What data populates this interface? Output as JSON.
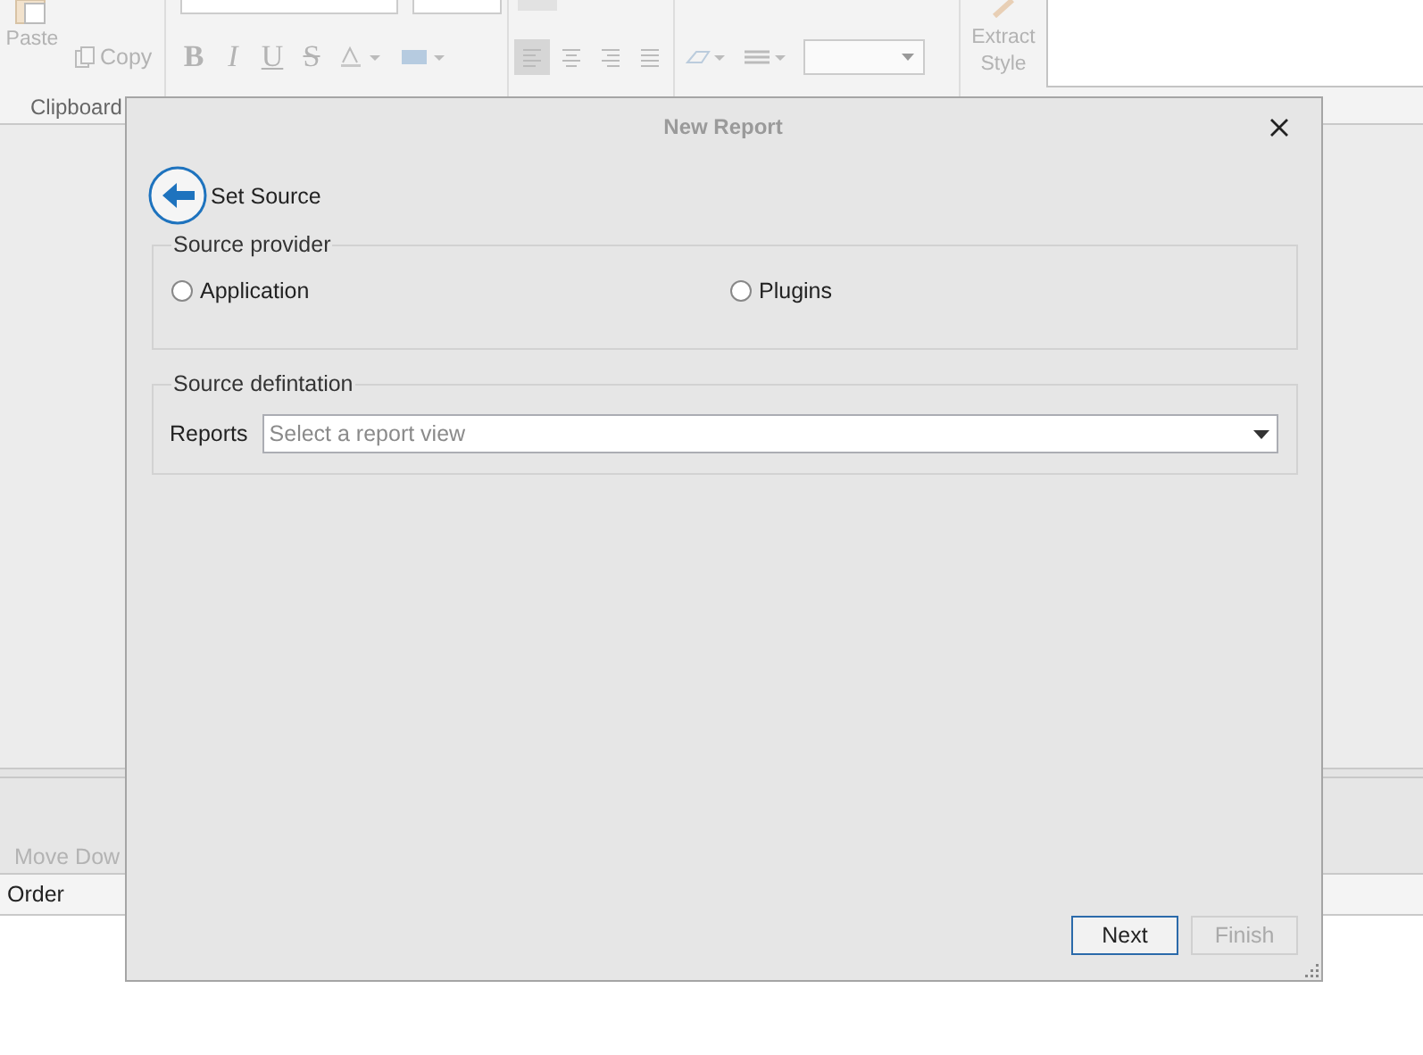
{
  "app": {
    "ribbon": {
      "paste": "Paste",
      "copy": "Copy",
      "clipboard_label": "Clipboard",
      "font_buttons": [
        "B",
        "I",
        "U",
        "S"
      ],
      "alignments": [
        {
          "selected": true
        },
        {
          "selected": false
        },
        {
          "selected": false
        },
        {
          "selected": false
        }
      ],
      "extract_style": "Extract Style"
    },
    "lower_panel": {
      "move_down": "Move Dow",
      "list_row": "Order"
    }
  },
  "dialog": {
    "title": "New Report",
    "step": "Set Source",
    "provider": {
      "legend": "Source provider",
      "options": [
        {
          "label": "Application",
          "selected": false
        },
        {
          "label": "Plugins",
          "selected": false
        }
      ]
    },
    "definition": {
      "legend": "Source defintation",
      "field_label": "Reports",
      "placeholder": "Select a report view"
    },
    "buttons": [
      {
        "label": "Next",
        "disabled": false
      },
      {
        "label": "Finish",
        "disabled": true
      }
    ]
  }
}
